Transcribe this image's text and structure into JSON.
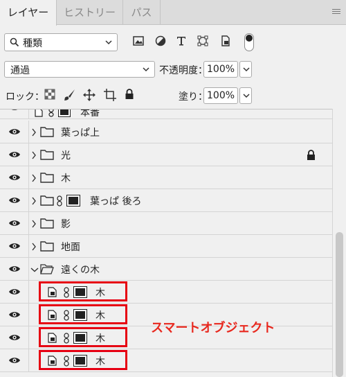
{
  "tabs": [
    {
      "label": "レイヤー",
      "active": true
    },
    {
      "label": "ヒストリー",
      "active": false
    },
    {
      "label": "パス",
      "active": false
    }
  ],
  "filter": {
    "kind_label": "種類"
  },
  "blend": {
    "mode": "通過",
    "opacity_label": "不透明度：",
    "opacity_value": "100%"
  },
  "lock": {
    "label": "ロック：",
    "fill_label": "塗り：",
    "fill_value": "100%"
  },
  "layers": [
    {
      "name": "本番",
      "type": "partial"
    },
    {
      "name": "葉っぱ上",
      "type": "group"
    },
    {
      "name": "光",
      "type": "group",
      "locked": true
    },
    {
      "name": "木",
      "type": "group"
    },
    {
      "name": "葉っぱ 後ろ",
      "type": "group-masked"
    },
    {
      "name": "影",
      "type": "group"
    },
    {
      "name": "地面",
      "type": "group"
    },
    {
      "name": "遠くの木",
      "type": "group",
      "expanded": true
    },
    {
      "name": "木",
      "type": "smart-object"
    },
    {
      "name": "木",
      "type": "smart-object"
    },
    {
      "name": "木",
      "type": "smart-object"
    },
    {
      "name": "木",
      "type": "smart-object"
    }
  ],
  "annotation": "スマートオブジェクト",
  "colors": {
    "highlight": "#e60012",
    "annotation": "#e8281e",
    "panel": "#f0f0f0"
  }
}
